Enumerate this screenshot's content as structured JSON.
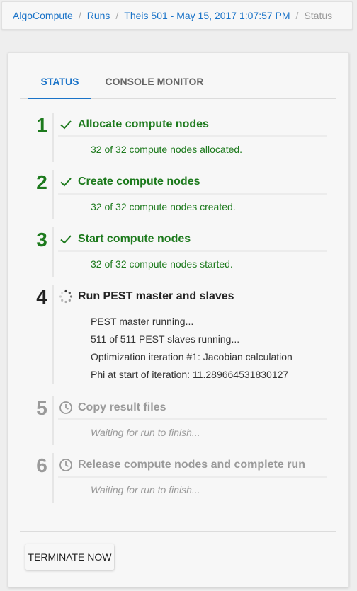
{
  "breadcrumb": {
    "items": [
      "AlgoCompute",
      "Runs",
      "Theis 501 - May 15, 2017 1:07:57 PM"
    ],
    "current": "Status",
    "separator": "/"
  },
  "tabs": [
    {
      "label": "STATUS",
      "active": true
    },
    {
      "label": "CONSOLE MONITOR",
      "active": false
    }
  ],
  "steps": [
    {
      "number": "1",
      "status": "done",
      "icon": "check-icon",
      "title": "Allocate compute nodes",
      "lines": [
        "32 of 32 compute nodes allocated."
      ]
    },
    {
      "number": "2",
      "status": "done",
      "icon": "check-icon",
      "title": "Create compute nodes",
      "lines": [
        "32 of 32 compute nodes created."
      ]
    },
    {
      "number": "3",
      "status": "done",
      "icon": "check-icon",
      "title": "Start compute nodes",
      "lines": [
        "32 of 32 compute nodes started."
      ]
    },
    {
      "number": "4",
      "status": "active",
      "icon": "spinner-icon",
      "title": "Run PEST master and slaves",
      "lines": [
        "PEST master running...",
        "511 of 511 PEST slaves running...",
        "Optimization iteration #1: Jacobian calculation",
        "Phi at start of iteration: 11.289664531830127"
      ]
    },
    {
      "number": "5",
      "status": "pending",
      "icon": "clock-icon",
      "title": "Copy result files",
      "lines": [
        "Waiting for run to finish..."
      ]
    },
    {
      "number": "6",
      "status": "pending",
      "icon": "clock-icon",
      "title": "Release compute nodes and complete run",
      "lines": [
        "Waiting for run to finish..."
      ]
    }
  ],
  "actions": {
    "terminate_label": "TERMINATE NOW"
  },
  "colors": {
    "accent": "#1a73c8",
    "success": "#1d7a1d",
    "muted": "#9a9a9a"
  }
}
